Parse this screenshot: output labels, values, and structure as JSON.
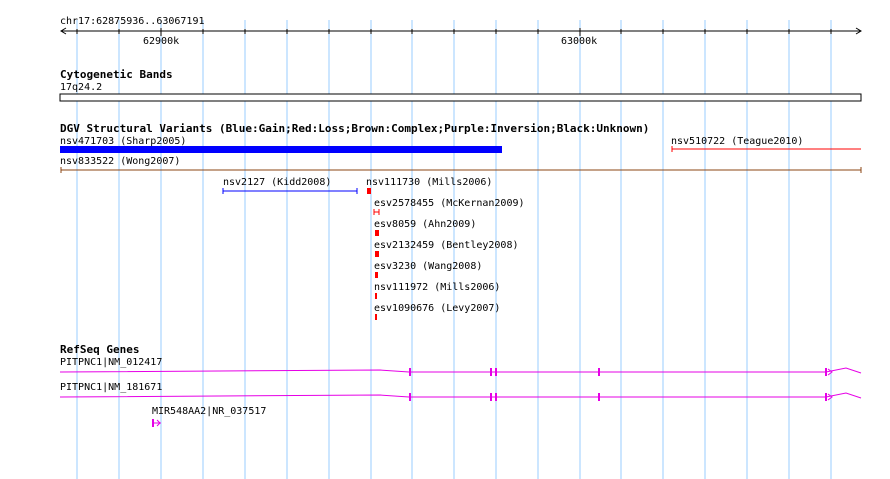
{
  "ruler": {
    "range_label": "chr17:62875936..63067191",
    "ticks": [
      {
        "label": "62900k",
        "pos": 62900000
      },
      {
        "label": "63000k",
        "pos": 63000000
      }
    ],
    "start": 62875936,
    "end": 63067191
  },
  "colors": {
    "gain": "#0000ff",
    "loss": "#ff0000",
    "complex": "#8b4513",
    "gene": "#e600e6",
    "grid": "#99ccff"
  },
  "tracks": {
    "cytoband": {
      "title": "Cytogenetic Bands",
      "band": "17q24.2"
    },
    "dgv": {
      "title": "DGV Structural Variants (Blue:Gain;Red:Loss;Brown:Complex;Purple:Inversion;Black:Unknown)",
      "features": [
        {
          "id": "nsv471703",
          "label": "nsv471703 (Sharp2005)",
          "type": "gain"
        },
        {
          "id": "nsv510722",
          "label": "nsv510722 (Teague2010)",
          "type": "loss"
        },
        {
          "id": "nsv833522",
          "label": "nsv833522 (Wong2007)",
          "type": "complex"
        },
        {
          "id": "nsv2127",
          "label": "nsv2127 (Kidd2008)",
          "type": "gain"
        },
        {
          "id": "nsv111730",
          "label": "nsv111730 (Mills2006)",
          "type": "loss"
        },
        {
          "id": "esv2578455",
          "label": "esv2578455 (McKernan2009)",
          "type": "loss"
        },
        {
          "id": "esv8059",
          "label": "esv8059 (Ahn2009)",
          "type": "loss"
        },
        {
          "id": "esv2132459",
          "label": "esv2132459 (Bentley2008)",
          "type": "loss"
        },
        {
          "id": "esv3230",
          "label": "esv3230 (Wang2008)",
          "type": "loss"
        },
        {
          "id": "nsv111972",
          "label": "nsv111972 (Mills2006)",
          "type": "loss"
        },
        {
          "id": "esv1090676",
          "label": "esv1090676 (Levy2007)",
          "type": "loss"
        }
      ]
    },
    "refseq": {
      "title": "RefSeq Genes",
      "genes": [
        {
          "id": "pitpnc1-012417",
          "label": "PITPNC1|NM_012417"
        },
        {
          "id": "pitpnc1-181671",
          "label": "PITPNC1|NM_181671"
        },
        {
          "id": "mir548aa2",
          "label": "MIR548AA2|NR_037517"
        }
      ]
    }
  }
}
